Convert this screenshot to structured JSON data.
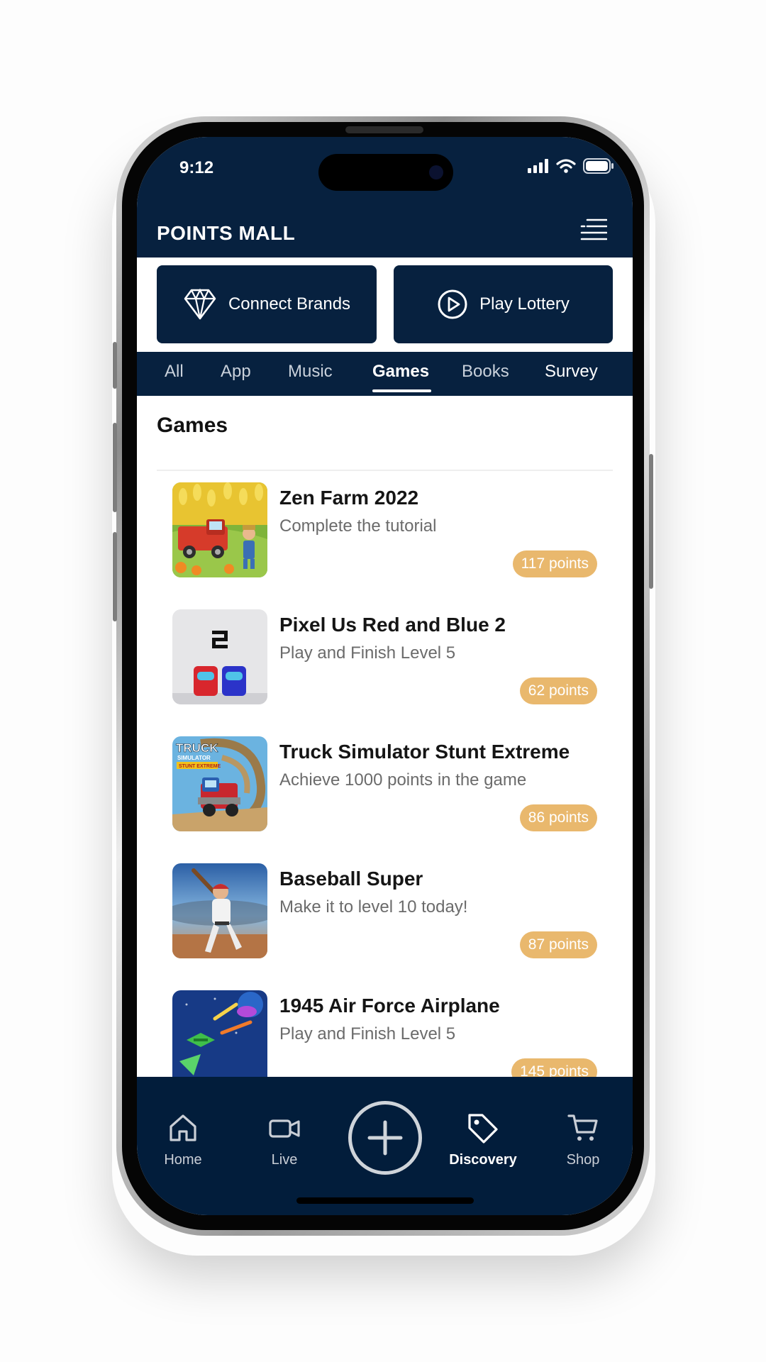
{
  "status_bar": {
    "time": "9:12"
  },
  "header": {
    "title": "POINTS MALL"
  },
  "actions": {
    "connect_label": "Connect Brands",
    "lottery_label": "Play Lottery"
  },
  "tabs": [
    {
      "label": "All"
    },
    {
      "label": "App"
    },
    {
      "label": "Music"
    },
    {
      "label": "Games",
      "active": true
    },
    {
      "label": "Books"
    },
    {
      "label": "Survey"
    }
  ],
  "section": {
    "title": "Games"
  },
  "games": [
    {
      "title": "Zen Farm 2022",
      "task": "Complete the tutorial",
      "points": "117 points",
      "icon": "farm-game-icon"
    },
    {
      "title": "Pixel Us Red and Blue 2",
      "task": "Play and Finish Level 5",
      "points": "62 points",
      "icon": "pixel-game-icon"
    },
    {
      "title": "Truck Simulator Stunt Extreme",
      "task": "Achieve 1000 points in the game",
      "points": "86 points",
      "icon": "truck-game-icon",
      "icon_text": [
        "TRUCK",
        "SIMULATOR",
        "STUNT EXTREME"
      ]
    },
    {
      "title": "Baseball Super",
      "task": "Make it to level 10 today!",
      "points": "87 points",
      "icon": "baseball-game-icon"
    },
    {
      "title": "1945 Air Force Airplane",
      "task": "Play and Finish Level 5",
      "points": "145 points",
      "icon": "airplane-game-icon"
    }
  ],
  "bottom_nav": [
    {
      "label": "Home",
      "icon": "home-icon"
    },
    {
      "label": "Live",
      "icon": "video-camera-icon"
    },
    {
      "label": "",
      "icon": "plus-icon"
    },
    {
      "label": "Discovery",
      "icon": "tag-icon",
      "active": true
    },
    {
      "label": "Shop",
      "icon": "cart-icon"
    }
  ],
  "colors": {
    "navy": "#07213f",
    "points_badge": "#e9b86d",
    "background": "#ffffff"
  }
}
